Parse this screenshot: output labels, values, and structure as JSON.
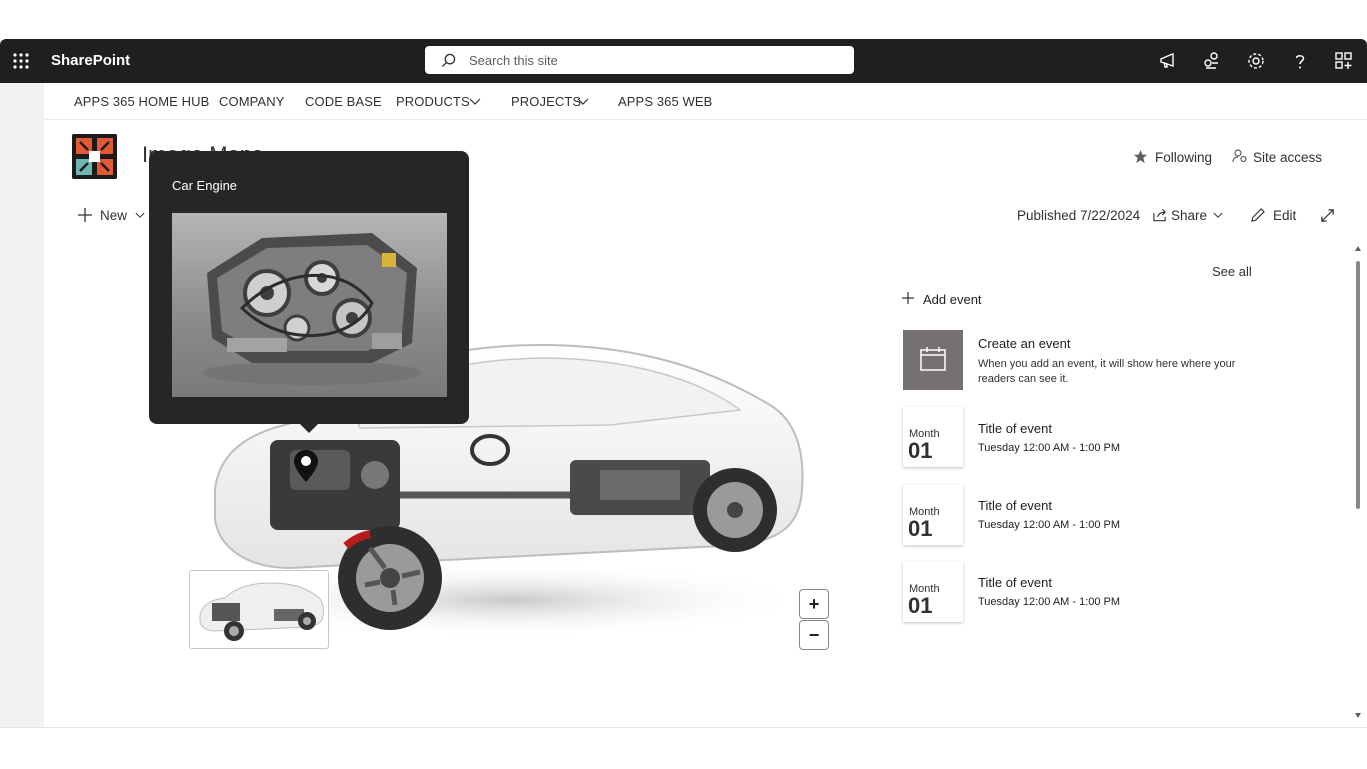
{
  "suite": {
    "brand": "SharePoint",
    "search_placeholder": "Search this site"
  },
  "hub_nav": {
    "items": [
      {
        "label": "APPS 365 HOME HUB"
      },
      {
        "label": "COMPANY"
      },
      {
        "label": "CODE BASE"
      },
      {
        "label": "PRODUCTS"
      },
      {
        "label": "PROJECTS"
      },
      {
        "label": "APPS 365 WEB"
      }
    ]
  },
  "site": {
    "title": "Image Maps",
    "following_label": "Following",
    "site_access_label": "Site access"
  },
  "command_bar": {
    "new_label": "New",
    "published": "Published 7/22/2024",
    "share_label": "Share",
    "edit_label": "Edit"
  },
  "image_map": {
    "popup_title": "Car Engine",
    "zoom_in": "+",
    "zoom_out": "−"
  },
  "events": {
    "see_all": "See all",
    "add_event": "Add event",
    "empty_title": "Create an event",
    "empty_desc_line1": "When you add an event, it will show here where your",
    "empty_desc_line2": "readers can see it.",
    "items": [
      {
        "month": "Month",
        "day": "01",
        "title": "Title of event",
        "time": "Tuesday 12:00 AM - 1:00 PM"
      },
      {
        "month": "Month",
        "day": "01",
        "title": "Title of event",
        "time": "Tuesday 12:00 AM - 1:00 PM"
      },
      {
        "month": "Month",
        "day": "01",
        "title": "Title of event",
        "time": "Tuesday 12:00 AM - 1:00 PM"
      }
    ]
  },
  "colors": {
    "suite_bar": "#1f1f1f",
    "popup_bg": "#262626",
    "calendar_tile": "#767171"
  }
}
